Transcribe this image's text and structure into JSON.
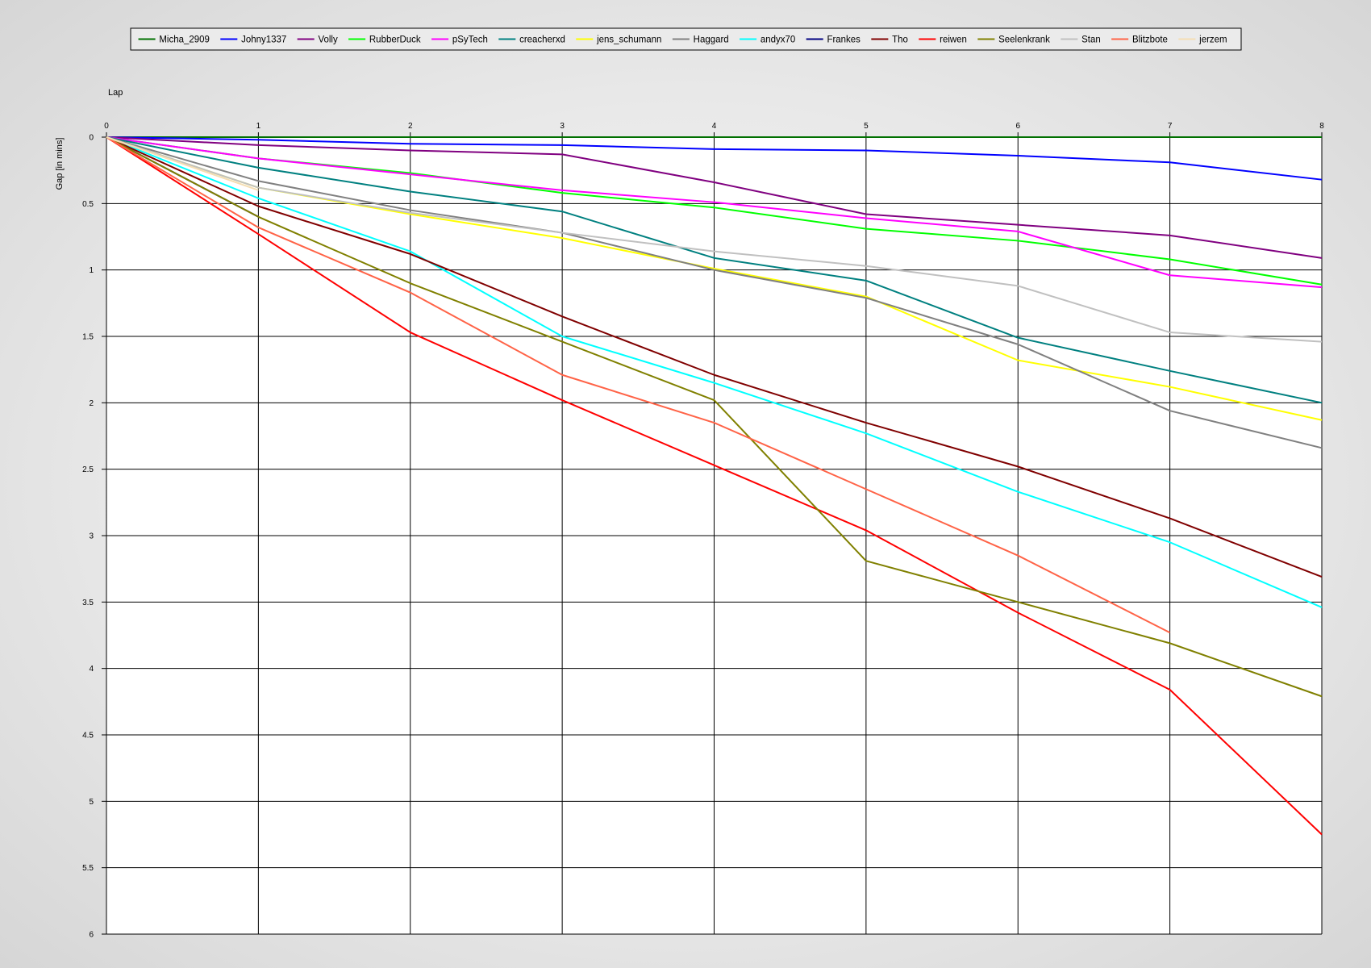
{
  "chart_data": {
    "type": "line",
    "xlabel": "Lap",
    "ylabel": "Gap [in mins]",
    "xlim": [
      0,
      8
    ],
    "ylim": [
      0,
      6
    ],
    "y_inverted": true,
    "grid": true,
    "legend": "top",
    "x_ticks": [
      0,
      1,
      2,
      3,
      4,
      5,
      6,
      7,
      8
    ],
    "y_ticks": [
      0,
      0.5,
      1,
      1.5,
      2,
      2.5,
      3,
      3.5,
      4,
      4.5,
      5,
      5.5,
      6
    ],
    "x": [
      0,
      1,
      2,
      3,
      4,
      5,
      6,
      7,
      8
    ],
    "series": [
      {
        "name": "Micha_2909",
        "color": "#007000",
        "values": [
          0,
          0,
          0,
          0,
          0,
          0,
          0,
          0,
          0
        ]
      },
      {
        "name": "Johny1337",
        "color": "#0000ff",
        "values": [
          0,
          0.02,
          0.05,
          0.06,
          0.09,
          0.1,
          0.14,
          0.19,
          0.32
        ]
      },
      {
        "name": "Volly",
        "color": "#800080",
        "values": [
          0,
          0.06,
          0.1,
          0.13,
          0.34,
          0.58,
          0.66,
          0.74,
          0.91
        ]
      },
      {
        "name": "RubberDuck",
        "color": "#00ff00",
        "values": [
          0,
          0.16,
          0.27,
          0.42,
          0.53,
          0.69,
          0.78,
          0.92,
          1.11
        ]
      },
      {
        "name": "pSyTech",
        "color": "#ff00ff",
        "values": [
          0,
          0.16,
          0.28,
          0.4,
          0.49,
          0.61,
          0.71,
          1.04,
          1.13
        ]
      },
      {
        "name": "creacherxd",
        "color": "#008080",
        "values": [
          0,
          0.23,
          0.41,
          0.56,
          0.91,
          1.08,
          1.51,
          1.76,
          2.0
        ]
      },
      {
        "name": "jens_schumann",
        "color": "#ffff00",
        "values": [
          0,
          0.38,
          0.58,
          0.76,
          0.99,
          1.2,
          1.68,
          1.88,
          2.13
        ]
      },
      {
        "name": "Haggard",
        "color": "#808080",
        "values": [
          0,
          0.33,
          0.55,
          0.72,
          1.0,
          1.21,
          1.56,
          2.06,
          2.34
        ]
      },
      {
        "name": "andyx70",
        "color": "#00ffff",
        "values": [
          0,
          0.46,
          0.86,
          1.5,
          1.85,
          2.23,
          2.67,
          3.05,
          3.54
        ]
      },
      {
        "name": "Frankes",
        "color": "#000080",
        "values": [
          0,
          0.6
        ]
      },
      {
        "name": "Tho",
        "color": "#800000",
        "values": [
          0,
          0.52,
          0.88,
          1.35,
          1.79,
          2.15,
          2.48,
          2.87,
          3.31
        ]
      },
      {
        "name": "reiwen",
        "color": "#ff0000",
        "values": [
          0,
          0.73,
          1.47,
          1.98,
          2.47,
          2.96,
          3.58,
          4.16,
          5.25
        ]
      },
      {
        "name": "Seelenkrank",
        "color": "#808000",
        "values": [
          0,
          0.6,
          1.1,
          1.54,
          1.98,
          3.19,
          3.5,
          3.81,
          4.21
        ]
      },
      {
        "name": "Stan",
        "color": "#c0c0c0",
        "values": [
          0,
          0.38,
          0.57,
          0.72,
          0.86,
          0.97,
          1.12,
          1.47,
          1.54
        ]
      },
      {
        "name": "Blitzbote",
        "color": "#ff6347",
        "values": [
          0,
          0.68,
          1.17,
          1.79,
          2.15,
          2.65,
          3.15,
          3.73
        ]
      },
      {
        "name": "jerzem",
        "color": "#f5deb3",
        "values": [
          0,
          0.4
        ]
      }
    ]
  }
}
